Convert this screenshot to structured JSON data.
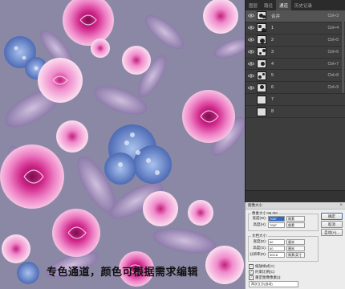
{
  "caption": "专色通道，颜色可根据需求编辑",
  "channels_panel": {
    "tabs": [
      "图层",
      "路径",
      "通道",
      "历史记录"
    ],
    "active_tab": 2,
    "rows": [
      {
        "name": "合并",
        "shortcut": "Ctrl+3",
        "visible": true,
        "selected": true
      },
      {
        "name": "1",
        "shortcut": "Ctrl+4",
        "visible": true,
        "selected": false
      },
      {
        "name": "2",
        "shortcut": "Ctrl+5",
        "visible": true,
        "selected": false
      },
      {
        "name": "3",
        "shortcut": "Ctrl+6",
        "visible": true,
        "selected": false
      },
      {
        "name": "4",
        "shortcut": "Ctrl+7",
        "visible": true,
        "selected": false
      },
      {
        "name": "5",
        "shortcut": "Ctrl+8",
        "visible": true,
        "selected": false
      },
      {
        "name": "6",
        "shortcut": "Ctrl+9",
        "visible": true,
        "selected": false
      },
      {
        "name": "7",
        "shortcut": "",
        "visible": false,
        "selected": false
      },
      {
        "name": "8",
        "shortcut": "",
        "visible": false,
        "selected": false
      }
    ]
  },
  "dialog": {
    "title": "图像大小",
    "pixel_size_label": "像素大小:96.0M",
    "width_label": "宽度(W):",
    "width_value": "7087",
    "height_label": "高度(H):",
    "height_value": "7087",
    "unit_pixels": "像素",
    "doc_size_label": "文档大小:",
    "doc_width_label": "宽度(D):",
    "doc_width_value": "60",
    "doc_height_label": "高度(G):",
    "doc_height_value": "60",
    "resolution_label": "分辨率(R):",
    "resolution_value": "304.8",
    "unit_cm": "厘米",
    "unit_ppi": "像素/英寸",
    "ok_label": "确定",
    "cancel_label": "取消",
    "auto_label": "自动(A)...",
    "scale_styles_label": "缩放样式(Y)",
    "constrain_label": "约束比例(C)",
    "resample_label": "重定图像像素(I):",
    "resample_method": "两次立方(自动)"
  },
  "colors": {
    "background": "#8b88a5",
    "rose_magenta": "#d62f8c",
    "rose_pink": "#f29cd0",
    "hydrangea_blue": "#6f8fd0",
    "leaf_lavender": "#a58fbf",
    "panel_bg": "#3d3d3d"
  }
}
